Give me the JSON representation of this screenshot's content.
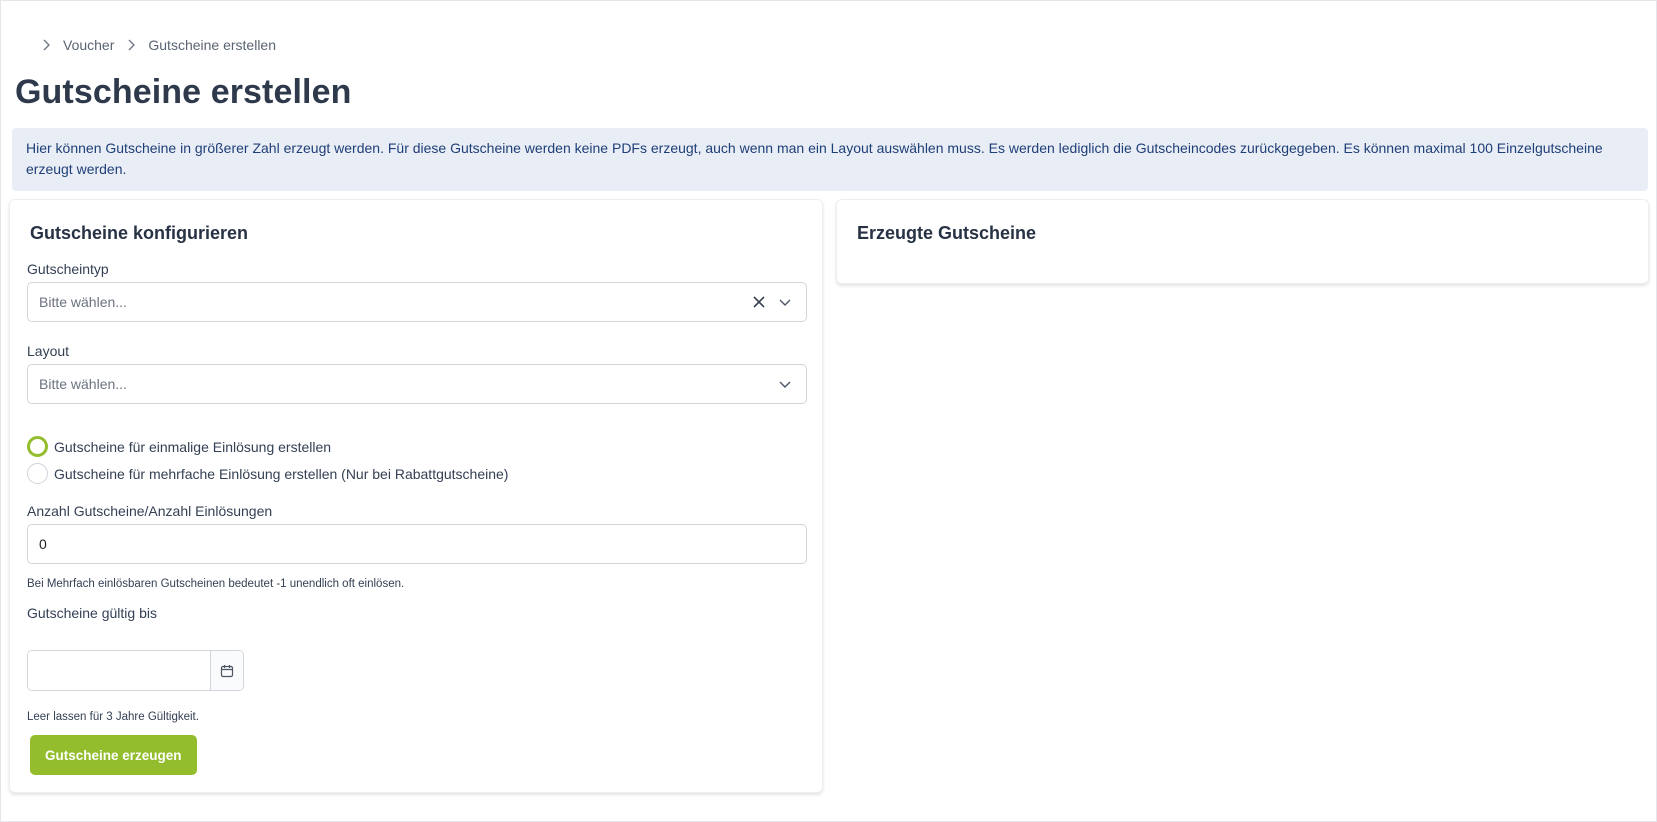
{
  "breadcrumb": {
    "items": [
      "Voucher",
      "Gutscheine erstellen"
    ]
  },
  "page_title": "Gutscheine erstellen",
  "info_text": "Hier können Gutscheine in größerer Zahl erzeugt werden. Für diese Gutscheine werden keine PDFs erzeugt, auch wenn man ein Layout auswählen muss. Es werden lediglich die Gutscheincodes zurückgegeben. Es können maximal 100 Einzelgutscheine erzeugt werden.",
  "config_card": {
    "title": "Gutscheine konfigurieren",
    "voucher_type": {
      "label": "Gutscheintyp",
      "placeholder": "Bitte wählen..."
    },
    "layout": {
      "label": "Layout",
      "placeholder": "Bitte wählen..."
    },
    "radio_options": [
      {
        "label": "Gutscheine für einmalige Einlösung erstellen",
        "checked": true
      },
      {
        "label": "Gutscheine für mehrfache Einlösung erstellen (Nur bei Rabattgutscheine)",
        "checked": false
      }
    ],
    "count": {
      "label": "Anzahl Gutscheine/Anzahl Einlösungen",
      "value": "0",
      "help": "Bei Mehrfach einlösbaren Gutscheinen bedeutet -1 unendlich oft einlösen."
    },
    "valid_until": {
      "label": "Gutscheine gültig bis",
      "value": "",
      "help": "Leer lassen für 3 Jahre Gültigkeit."
    },
    "submit_label": "Gutscheine erzeugen"
  },
  "result_card": {
    "title": "Erzeugte Gutscheine"
  },
  "colors": {
    "accent": "#93bd2c",
    "info_bg": "#e9edf5",
    "info_text": "#1f3f78",
    "heading": "#2e3a4c"
  },
  "icons": {
    "breadcrumb_separator": "chevron-right-icon",
    "select_clear": "close-icon",
    "select_open": "chevron-down-icon",
    "date_picker": "calendar-icon"
  }
}
